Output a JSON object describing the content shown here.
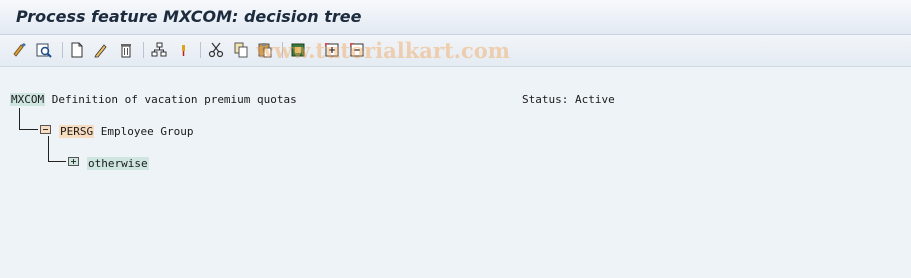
{
  "window": {
    "title": "Process feature MXCOM: decision tree"
  },
  "toolbar": {
    "buttons": [
      {
        "name": "check-icon",
        "tooltip": ""
      },
      {
        "name": "display-object-icon",
        "tooltip": ""
      },
      {
        "name": "create-icon",
        "tooltip": ""
      },
      {
        "name": "change-icon",
        "tooltip": ""
      },
      {
        "name": "delete-icon",
        "tooltip": ""
      },
      {
        "name": "structure-icon",
        "tooltip": ""
      },
      {
        "name": "pin-icon",
        "tooltip": ""
      },
      {
        "name": "cut-icon",
        "tooltip": ""
      },
      {
        "name": "copy-icon",
        "tooltip": ""
      },
      {
        "name": "paste-icon",
        "tooltip": ""
      },
      {
        "name": "insert-subnode-icon",
        "tooltip": ""
      },
      {
        "name": "expand-subtree-icon",
        "tooltip": ""
      },
      {
        "name": "collapse-subtree-icon",
        "tooltip": ""
      }
    ]
  },
  "watermark": "www.tutorialkart.com",
  "tree": {
    "root": {
      "code": "MXCOM",
      "description": "Definition of vacation premium quotas",
      "status_label": "Status: Active"
    },
    "level1": {
      "code": "PERSG",
      "description": "Employee Group"
    },
    "level2": {
      "label": "otherwise"
    }
  }
}
